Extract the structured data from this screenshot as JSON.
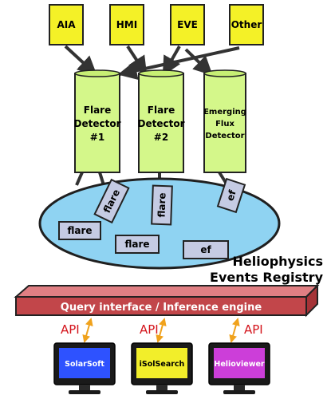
{
  "sources": [
    "AIA",
    "HMI",
    "EVE",
    "Other"
  ],
  "detectors": [
    [
      "Flare",
      "Detector",
      "#1"
    ],
    [
      "Flare",
      "Detector",
      "#2"
    ],
    [
      "Emerging",
      "Flux",
      "Detector"
    ]
  ],
  "events": [
    "flare",
    "flare",
    "flare",
    "ef",
    "flare",
    "flare",
    "ef"
  ],
  "registry": [
    "Heliophysics",
    "Events Registry"
  ],
  "query_label": "Query interface / Inference engine",
  "api_label": "API",
  "clients": [
    "SolarSoft",
    "iSolSearch",
    "Helioviewer"
  ],
  "colors": {
    "source_fill": "#f4f127",
    "detector_fill": "#d4f78a",
    "ellipse_fill": "#8fd3f2",
    "event_fill": "#c5cbe3",
    "bar_fill": "#c2464a",
    "api_red": "#d4141c",
    "api_arrow": "#f0a21c",
    "solarsoft_screen": "#2e52ff",
    "isolsearch_screen": "#f2ee2a",
    "helioviewer_screen": "#cc3ed9"
  }
}
